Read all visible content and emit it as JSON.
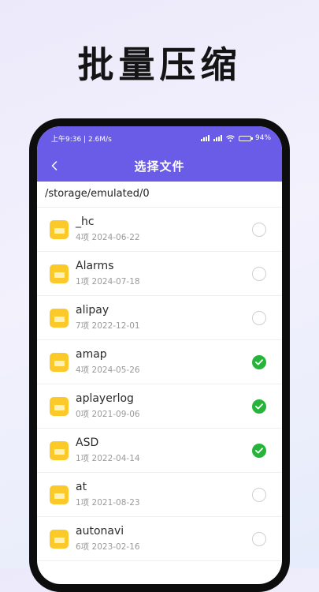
{
  "promo": {
    "title": "批量压缩"
  },
  "status_bar": {
    "time": "上午9:36 | 2.6M/s",
    "battery": "94",
    "battery_level": 0.94
  },
  "nav": {
    "title": "选择文件"
  },
  "path": "/storage/emulated/0",
  "colors": {
    "accent": "#6b5ce7",
    "folder": "#fcc92b",
    "checked": "#27b43b"
  },
  "files": [
    {
      "name": "_hc",
      "count": "4项",
      "date": "2024-06-22",
      "selected": false
    },
    {
      "name": "Alarms",
      "count": "1项",
      "date": "2024-07-18",
      "selected": false
    },
    {
      "name": "alipay",
      "count": "7项",
      "date": "2022-12-01",
      "selected": false
    },
    {
      "name": "amap",
      "count": "4项",
      "date": "2024-05-26",
      "selected": true
    },
    {
      "name": "aplayerlog",
      "count": "0项",
      "date": "2021-09-06",
      "selected": true
    },
    {
      "name": "ASD",
      "count": "1项",
      "date": "2022-04-14",
      "selected": true
    },
    {
      "name": "at",
      "count": "1项",
      "date": "2021-08-23",
      "selected": false
    },
    {
      "name": "autonavi",
      "count": "6项",
      "date": "2023-02-16",
      "selected": false
    }
  ]
}
